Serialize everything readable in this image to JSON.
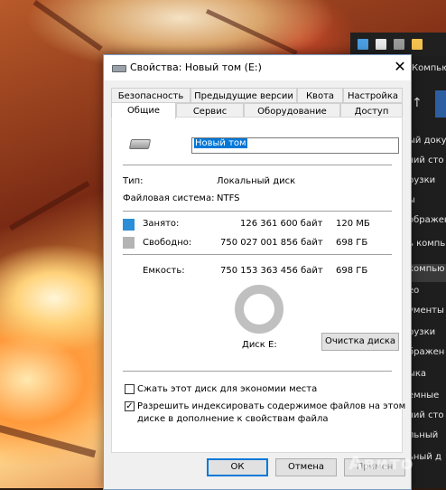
{
  "explorer": {
    "title": "Компью",
    "items": [
      "ый доку",
      "чий сто",
      "рузки",
      "ы",
      "ображен",
      "ь компь",
      "компью",
      "ео",
      "ументы",
      "рузки",
      "бражен",
      "ыка",
      "емные",
      "чий сто",
      "льный",
      "ьный д"
    ]
  },
  "dialog": {
    "title": "Свойства: Новый том (E:)",
    "close": "✕",
    "tabs_top": [
      "Безопасность",
      "Предыдущие версии",
      "Квота",
      "Настройка"
    ],
    "tabs_bottom": [
      "Общие",
      "Сервис",
      "Оборудование",
      "Доступ"
    ],
    "volume_name": "Новый том",
    "type_label": "Тип:",
    "type_value": "Локальный диск",
    "fs_label": "Файловая система:",
    "fs_value": "NTFS",
    "used_label": "Занято:",
    "used_bytes": "126 361 600 байт",
    "used_short": "120 МБ",
    "free_label": "Свободно:",
    "free_bytes": "750 027 001 856 байт",
    "free_short": "698 ГБ",
    "capacity_label": "Емкость:",
    "capacity_bytes": "750 153 363 456 байт",
    "capacity_short": "698 ГБ",
    "disk_label": "Диск E:",
    "cleanup_button": "Очистка диска",
    "compress_label": "Сжать этот диск для экономии места",
    "compress_checked": false,
    "index_label_1": "Разрешить индексировать содержимое файлов на этом",
    "index_label_2": "диске в дополнение к свойствам файла",
    "index_checked": true,
    "check_mark": "✓",
    "ok_button": "ОК",
    "cancel_button": "Отмена",
    "apply_button": "Примен",
    "colors": {
      "used": "#2b8ed6",
      "free": "#b4b4b4",
      "accent": "#0078d7"
    }
  },
  "watermark": "Авито"
}
